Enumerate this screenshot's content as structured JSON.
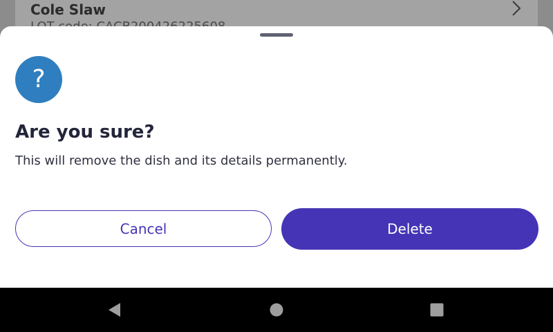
{
  "background": {
    "item_title": "Cole Slaw",
    "item_subtitle": "LOT code: CACB200426225608"
  },
  "dialog": {
    "icon": "question-mark-icon",
    "icon_glyph": "?",
    "title": "Are you sure?",
    "message": "This will remove the dish and its details permanently.",
    "cancel_label": "Cancel",
    "delete_label": "Delete"
  },
  "navbar": {
    "back": "back-icon",
    "home": "home-icon",
    "recents": "recents-icon"
  },
  "colors": {
    "primary": "#4535b6",
    "info_icon_bg": "#2f7fc0",
    "text_dark": "#23253a"
  }
}
